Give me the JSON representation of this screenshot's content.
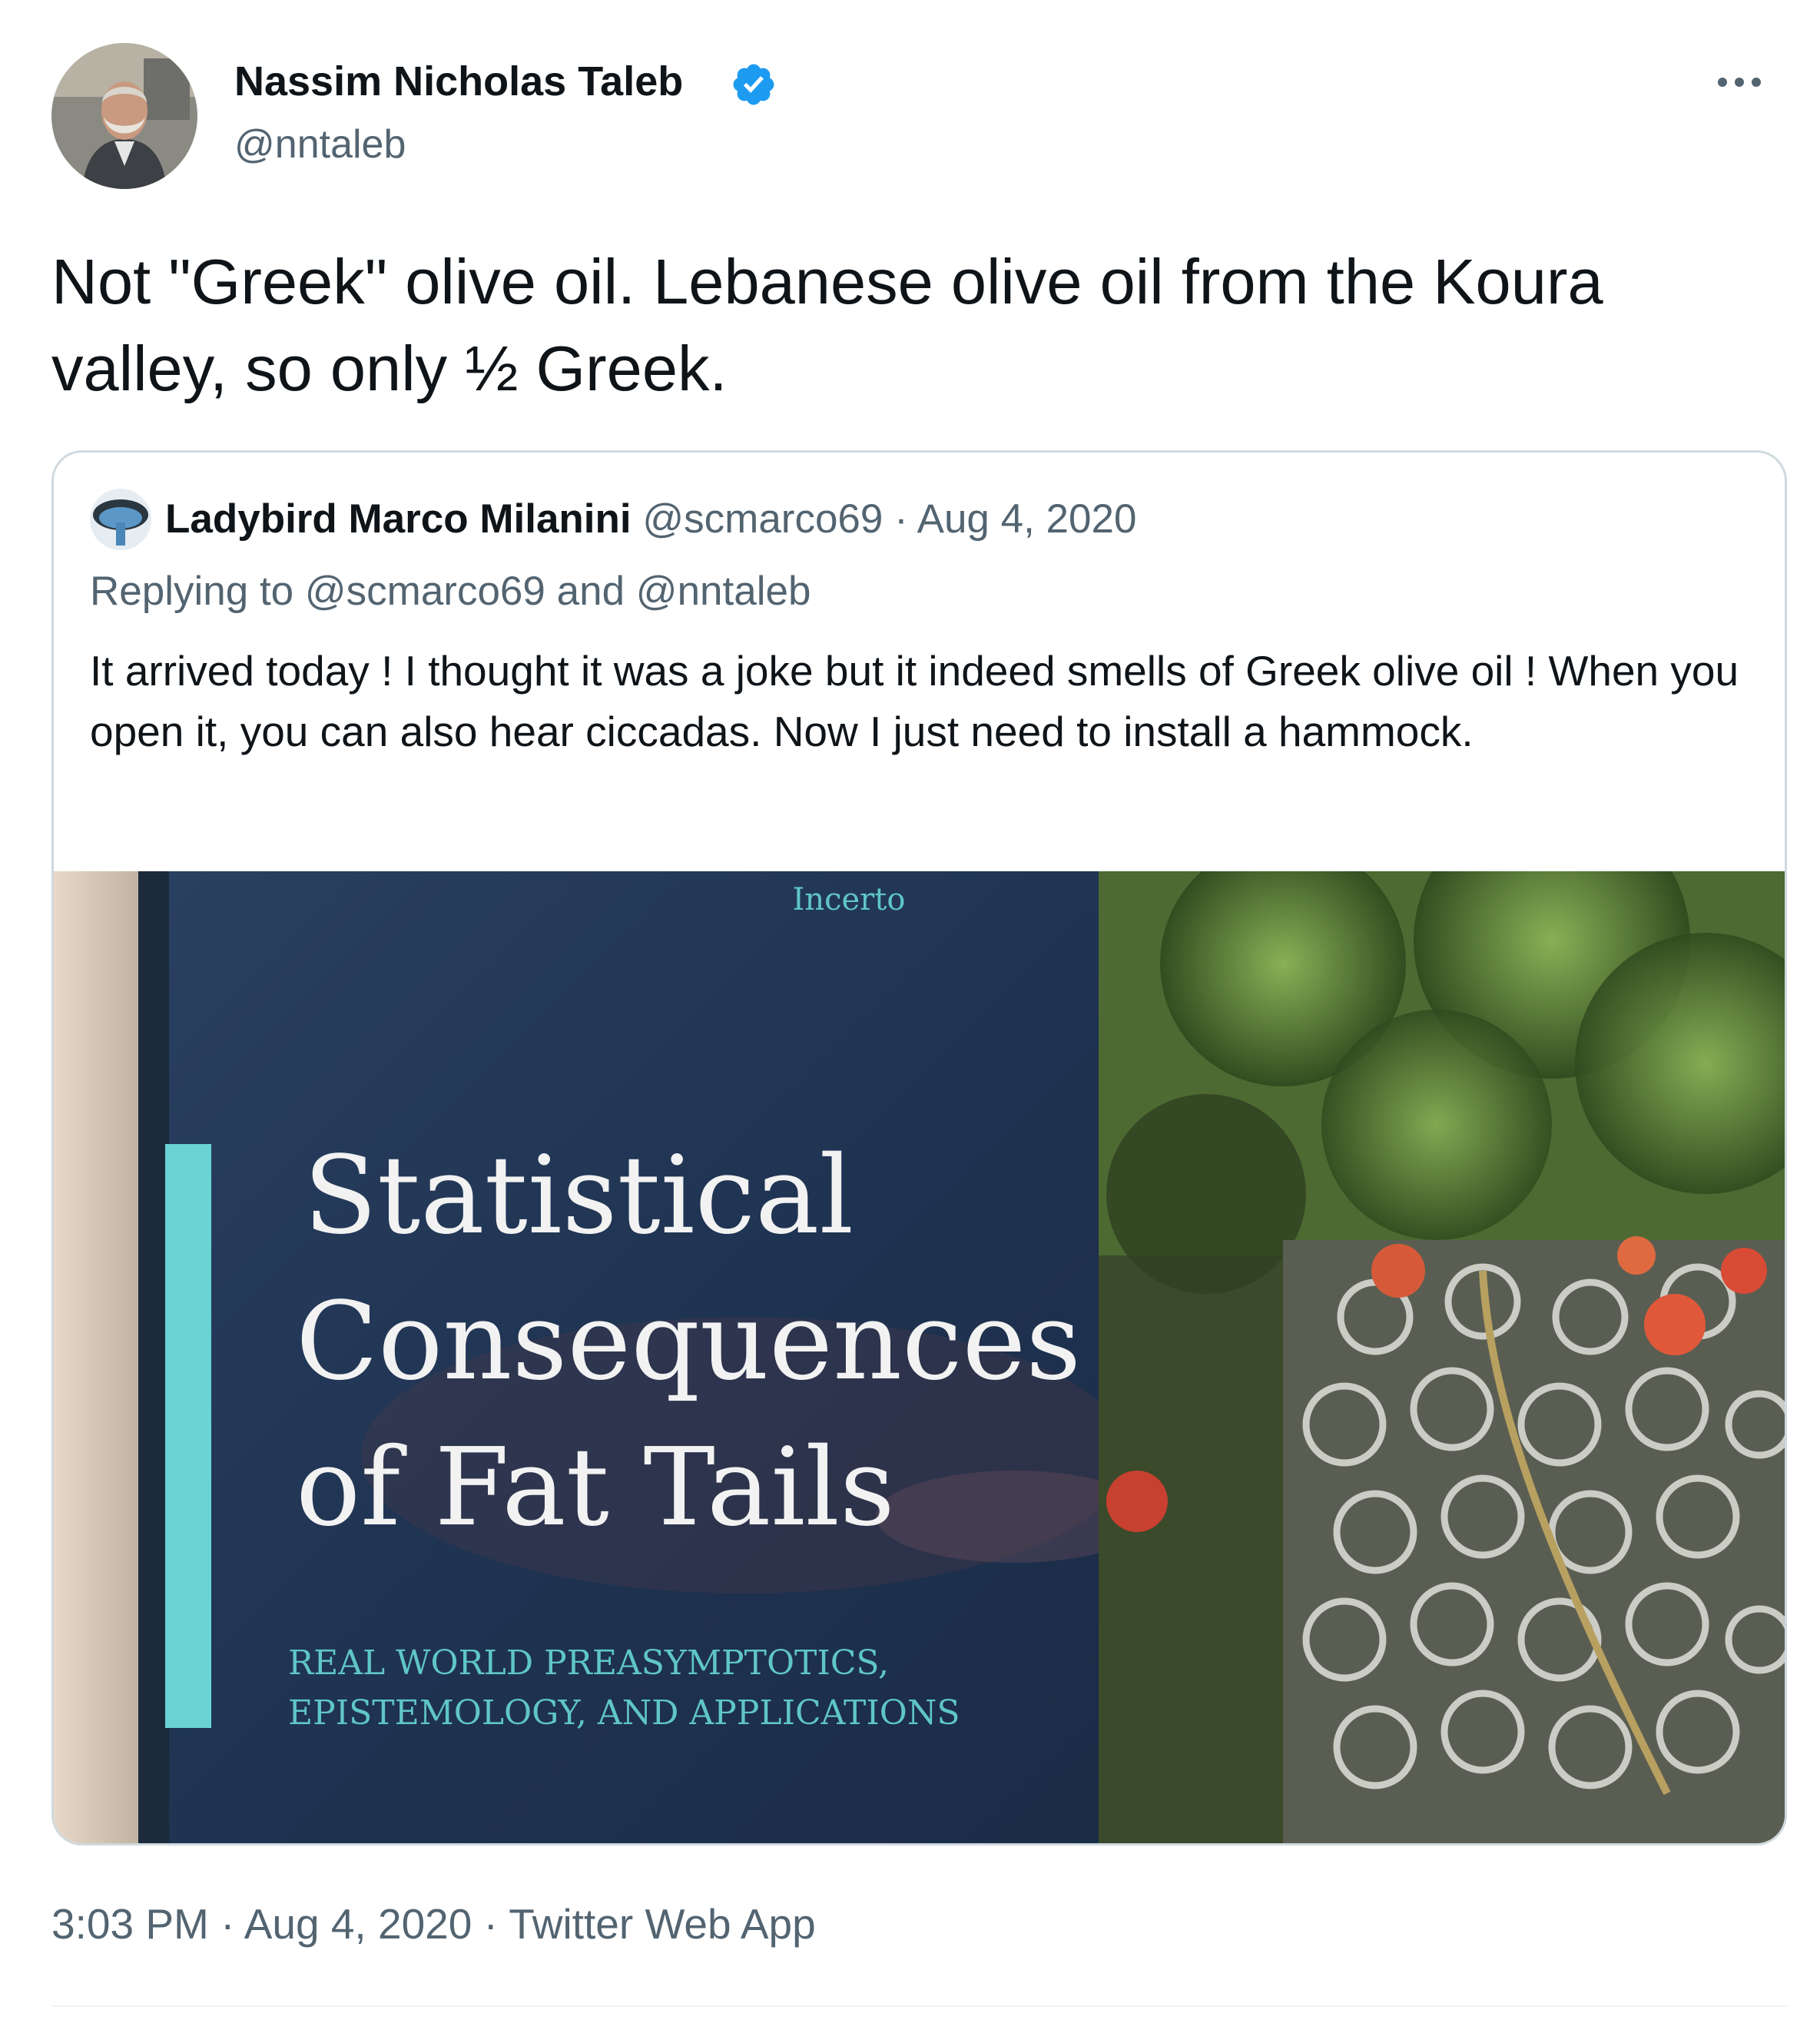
{
  "tweet": {
    "author_name": "Nassim Nicholas Taleb",
    "author_handle": "@nntaleb",
    "verified": true,
    "more_icon": "more-dots-icon",
    "text": "Not \"Greek\" olive oil. Lebanese olive oil from the Koura valley, so only ½ Greek.",
    "time": "3:03 PM",
    "separator": "·",
    "date": "Aug 4, 2020",
    "source": "Twitter Web App"
  },
  "quoted_tweet": {
    "author_name": "Ladybird Marco Milanini",
    "author_handle": "@scmarco69",
    "separator": "·",
    "date": "Aug 4, 2020",
    "replying_to": "Replying to @scmarco69 and @nntaleb",
    "text": "It arrived today ! I thought it was a joke but it indeed smells of Greek olive oil ! When you open it, you can also hear ciccadas. Now I just need to install a hammock.",
    "photo": {
      "series_label": "Incerto",
      "book_title_lines": [
        "Statistical",
        "Consequences",
        "of Fat Tails"
      ],
      "book_subtitle_lines": [
        "REAL WORLD PREASYMPTOTICS,",
        "EPISTEMOLOGY, AND APPLICATIONS"
      ]
    }
  },
  "colors": {
    "text_primary": "#0f1419",
    "text_secondary": "#536471",
    "verified_blue": "#1d9bf0",
    "border": "#cfd9de",
    "book_cover": "#1f3350",
    "book_accent": "#5fd0d0"
  }
}
